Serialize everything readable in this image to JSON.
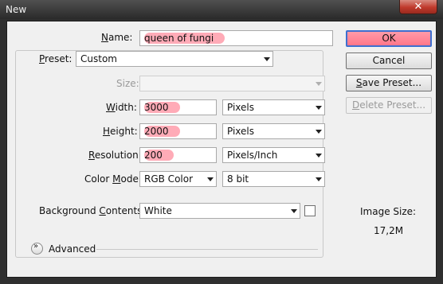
{
  "window": {
    "title": "New",
    "close_glyph": "✕"
  },
  "name": {
    "label_key": "N",
    "label_rest": "ame:",
    "value": "queen of fungi"
  },
  "preset": {
    "label_key": "P",
    "label_rest": "reset:",
    "value": "Custom"
  },
  "size": {
    "label": "Size:",
    "value": ""
  },
  "width": {
    "label_key": "W",
    "label_rest": "idth:",
    "value": "3000",
    "unit": "Pixels"
  },
  "height": {
    "label_key": "H",
    "label_rest": "eight:",
    "value": "2000",
    "unit": "Pixels"
  },
  "resolution": {
    "label_key": "R",
    "label_rest": "esolution:",
    "value": "200",
    "unit": "Pixels/Inch"
  },
  "color_mode": {
    "label_pre": "Color ",
    "label_key": "M",
    "label_rest": "ode:",
    "value": "RGB Color",
    "depth": "8 bit"
  },
  "background": {
    "label_pre": "Background ",
    "label_key": "C",
    "label_rest": "ontents:",
    "value": "White"
  },
  "advanced": {
    "label": "Advanced"
  },
  "buttons": {
    "ok": "OK",
    "cancel": "Cancel",
    "save_key": "S",
    "save_rest": "ave Preset...",
    "delete_key": "D",
    "delete_rest": "elete Preset..."
  },
  "image_size": {
    "label": "Image Size:",
    "value": "17,2M"
  },
  "colors": {
    "ok_fill": "#ff7689",
    "ok_border": "#3d6fcf",
    "highlight": "#ff7387",
    "close": "#c0392b"
  }
}
